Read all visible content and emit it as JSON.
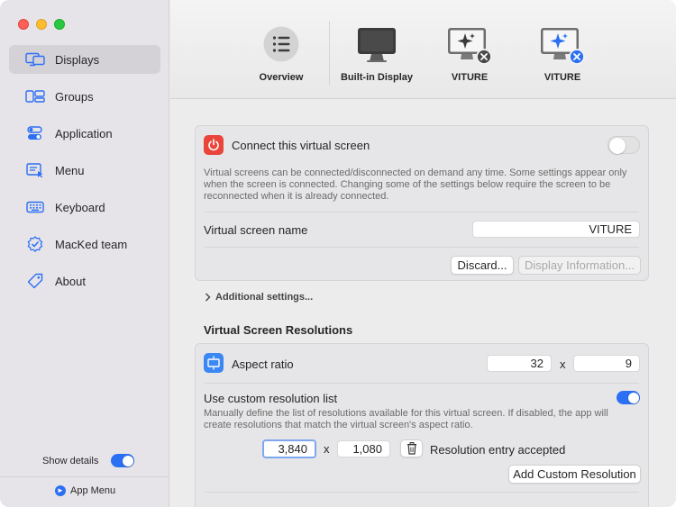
{
  "sidebar": {
    "items": [
      {
        "label": "Displays",
        "icon": "display-icon",
        "active": true
      },
      {
        "label": "Groups",
        "icon": "groups-icon"
      },
      {
        "label": "Application",
        "icon": "application-icon"
      },
      {
        "label": "Menu",
        "icon": "menu-icon"
      },
      {
        "label": "Keyboard",
        "icon": "keyboard-icon"
      },
      {
        "label": "MacKed team",
        "icon": "seal-check-icon"
      },
      {
        "label": "About",
        "icon": "tag-icon"
      }
    ],
    "show_details_label": "Show details",
    "show_details_on": true,
    "app_menu_label": "App Menu"
  },
  "toolbar": {
    "items": [
      {
        "label": "Overview",
        "icon": "list-icon"
      },
      {
        "label": "Built-in Display",
        "icon": "monitor-icon"
      },
      {
        "label": "VITURE",
        "icon": "virtual-monitor-icon"
      },
      {
        "label": "VITURE",
        "icon": "virtual-monitor-selected-icon",
        "selected": true
      }
    ]
  },
  "connect": {
    "title": "Connect this virtual screen",
    "enabled": false,
    "description": "Virtual screens can be connected/disconnected on demand any time. Some settings appear only when the screen is connected. Changing some of the settings below require the screen to be reconnected when it is already connected.",
    "name_label": "Virtual screen name",
    "name_value": "VITURE",
    "discard_label": "Discard...",
    "display_info_label": "Display Information..."
  },
  "additional_settings_label": "Additional settings...",
  "resolutions": {
    "section_title": "Virtual Screen Resolutions",
    "aspect_label": "Aspect ratio",
    "aspect_w": "32",
    "aspect_sep": "x",
    "aspect_h": "9",
    "custom_label": "Use custom resolution list",
    "custom_on": true,
    "custom_desc": "Manually define the list of resolutions available for this virtual screen. If disabled, the app will create resolutions that match the virtual screen's aspect ratio.",
    "res_w": "3,840",
    "res_sep": "x",
    "res_h": "1,080",
    "res_status": "Resolution entry accepted",
    "add_button": "Add Custom Resolution"
  },
  "colors": {
    "accent": "#2b6ff3",
    "power_red": "#e9453b",
    "aspect_blue": "#3b88f5"
  }
}
